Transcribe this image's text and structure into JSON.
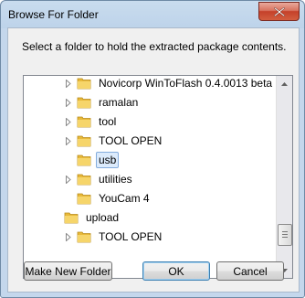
{
  "window": {
    "title": "Browse For Folder"
  },
  "dialog": {
    "instruction": "Select a folder to hold the extracted package contents."
  },
  "tree": {
    "items": [
      {
        "label": "Novicorp WinToFlash 0.4.0013 beta",
        "expander": true,
        "selected": false
      },
      {
        "label": "ramalan",
        "expander": true,
        "selected": false
      },
      {
        "label": "tool",
        "expander": true,
        "selected": false
      },
      {
        "label": "TOOL OPEN",
        "expander": true,
        "selected": false
      },
      {
        "label": "usb",
        "expander": false,
        "selected": true
      },
      {
        "label": "utilities",
        "expander": true,
        "selected": false
      },
      {
        "label": "YouCam 4",
        "expander": false,
        "selected": false
      },
      {
        "label": "upload",
        "expander": false,
        "selected": false
      },
      {
        "label": "TOOL OPEN",
        "expander": true,
        "selected": false
      }
    ]
  },
  "buttons": {
    "make_new_folder": "Make New Folder",
    "ok": "OK",
    "cancel": "Cancel"
  },
  "colors": {
    "folder": "#f2c94c",
    "selection_fill": "#dcebfc",
    "selection_border": "#84acdd",
    "close_button": "#c5402a"
  }
}
